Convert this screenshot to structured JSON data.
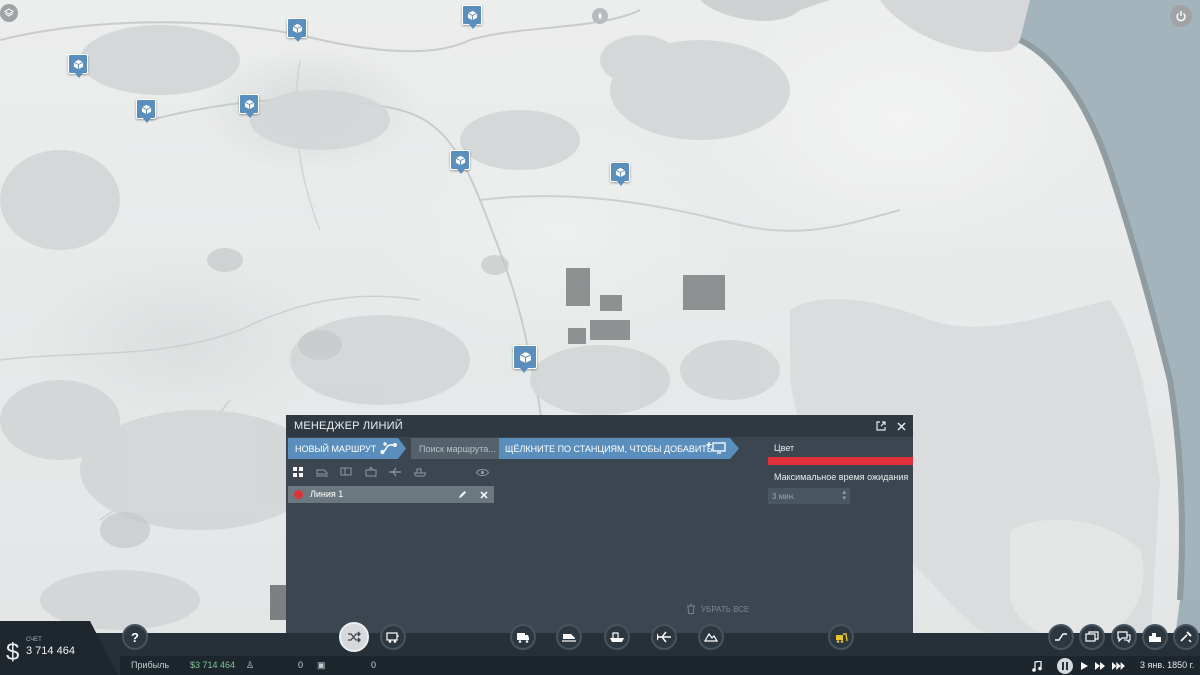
{
  "panel": {
    "title": "МЕНЕДЖЕР ЛИНИЙ",
    "new_route_label": "НОВЫЙ МАРШРУТ",
    "search_placeholder": "Поиск маршрута...",
    "hint_label": "ЩЁЛКНИТЕ ПО СТАНЦИЯМ, ЧТОБЫ ДОБАВИТЬ",
    "lines": [
      {
        "name": "Линия 1",
        "color": "#e0323a"
      }
    ],
    "color_label": "Цвет",
    "selected_color": "#e0323a",
    "max_wait_label": "Максимальное время ожидания",
    "max_wait_value": "3 мин.",
    "clear_all_label": "УБРАТЬ ВСЕ",
    "filters": [
      "all-icon",
      "train-icon",
      "bus-icon",
      "tram-icon",
      "plane-icon",
      "ship-icon"
    ]
  },
  "account": {
    "label": "СЧЕТ",
    "value": "3 714 464"
  },
  "status": {
    "profit_label": "Прибыль",
    "profit_value": "$3 714 464",
    "passengers": "0",
    "cargo": "0",
    "date": "3 янв. 1850 г."
  },
  "colors": {
    "accent": "#5a8fbd",
    "panel_bg": "#3b4650",
    "bar_bg": "#263038"
  },
  "toolbar_icons": [
    "help-icon",
    "lines-icon",
    "vehicle-manager-icon",
    "road-vehicle-icon",
    "train-icon",
    "ship-icon",
    "plane-icon",
    "terrain-icon",
    "bulldoze-icon"
  ],
  "right_icons": [
    "line-icon",
    "cargo-icon",
    "chat-icon",
    "town-icon",
    "settings-icon"
  ]
}
